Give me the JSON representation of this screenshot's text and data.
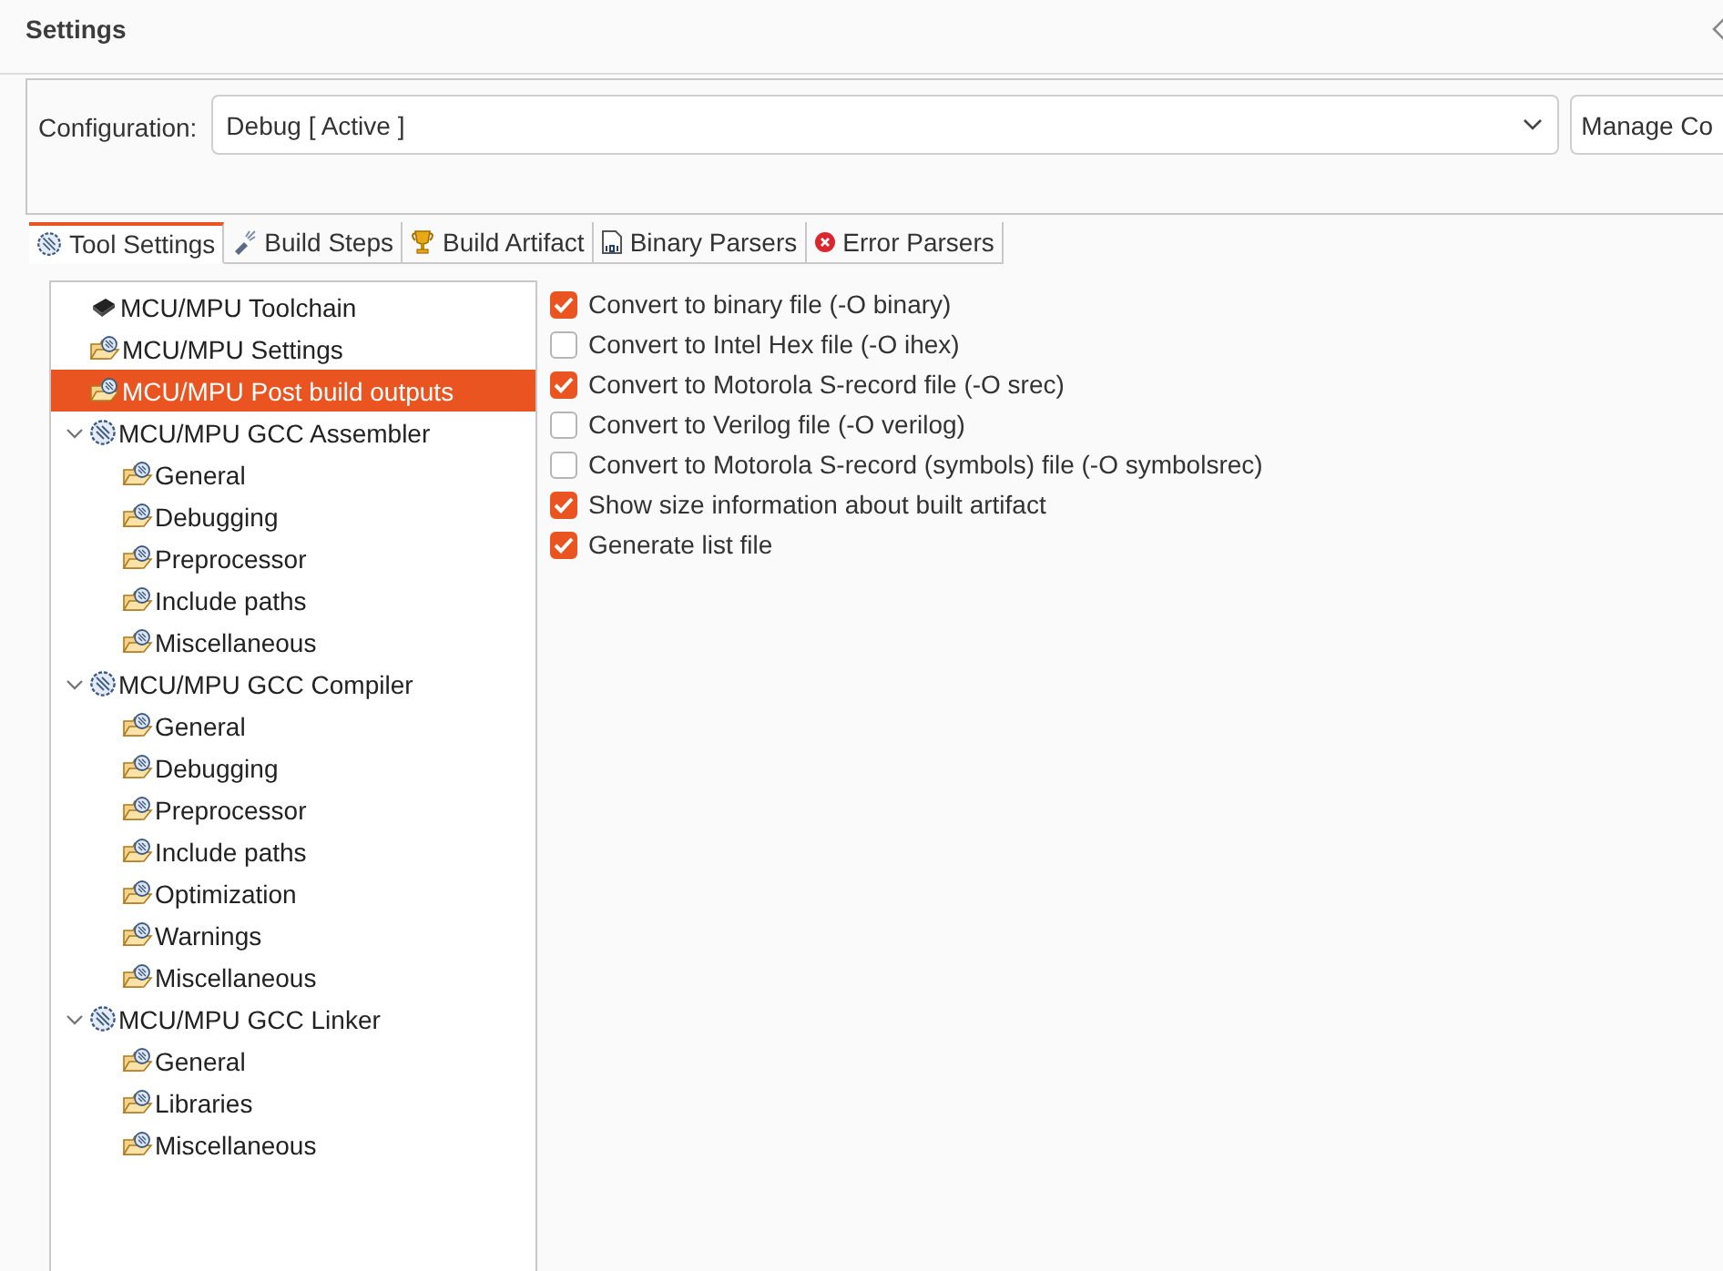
{
  "window": {
    "title": "Settings"
  },
  "configuration": {
    "label": "Configuration:",
    "value": "Debug  [ Active ]",
    "manage_button": "Manage Co"
  },
  "tabs": [
    {
      "label": "Tool Settings",
      "kind": "tool",
      "selected": true
    },
    {
      "label": "Build Steps",
      "kind": "steps",
      "selected": false
    },
    {
      "label": "Build Artifact",
      "kind": "trophy",
      "selected": false
    },
    {
      "label": "Binary Parsers",
      "kind": "binary",
      "selected": false
    },
    {
      "label": "Error Parsers",
      "kind": "error",
      "selected": false
    }
  ],
  "tree": [
    {
      "label": "MCU/MPU Toolchain",
      "kind": "chip",
      "selected": false
    },
    {
      "label": "MCU/MPU Settings",
      "kind": "folder",
      "selected": false
    },
    {
      "label": "MCU/MPU Post build outputs",
      "kind": "folder",
      "selected": true
    },
    {
      "label": "MCU/MPU GCC Assembler",
      "kind": "tool",
      "selected": false,
      "expanded": true,
      "children": [
        {
          "label": "General",
          "kind": "folder",
          "selected": false
        },
        {
          "label": "Debugging",
          "kind": "folder",
          "selected": false
        },
        {
          "label": "Preprocessor",
          "kind": "folder",
          "selected": false
        },
        {
          "label": "Include paths",
          "kind": "folder",
          "selected": false
        },
        {
          "label": "Miscellaneous",
          "kind": "folder",
          "selected": false
        }
      ]
    },
    {
      "label": "MCU/MPU GCC Compiler",
      "kind": "tool",
      "selected": false,
      "expanded": true,
      "children": [
        {
          "label": "General",
          "kind": "folder",
          "selected": false
        },
        {
          "label": "Debugging",
          "kind": "folder",
          "selected": false
        },
        {
          "label": "Preprocessor",
          "kind": "folder",
          "selected": false
        },
        {
          "label": "Include paths",
          "kind": "folder",
          "selected": false
        },
        {
          "label": "Optimization",
          "kind": "folder",
          "selected": false
        },
        {
          "label": "Warnings",
          "kind": "folder",
          "selected": false
        },
        {
          "label": "Miscellaneous",
          "kind": "folder",
          "selected": false
        }
      ]
    },
    {
      "label": "MCU/MPU GCC Linker",
      "kind": "tool",
      "selected": false,
      "expanded": true,
      "children": [
        {
          "label": "General",
          "kind": "folder",
          "selected": false
        },
        {
          "label": "Libraries",
          "kind": "folder",
          "selected": false
        },
        {
          "label": "Miscellaneous",
          "kind": "folder",
          "selected": false
        }
      ]
    }
  ],
  "options": [
    {
      "label": "Convert to binary file (-O binary)",
      "checked": true
    },
    {
      "label": "Convert to Intel Hex file (-O ihex)",
      "checked": false
    },
    {
      "label": "Convert to Motorola S-record file (-O srec)",
      "checked": true
    },
    {
      "label": "Convert to Verilog file (-O verilog)",
      "checked": false
    },
    {
      "label": "Convert to Motorola S-record (symbols) file (-O symbolsrec)",
      "checked": false
    },
    {
      "label": "Show size information about built artifact",
      "checked": true
    },
    {
      "label": "Generate list file",
      "checked": true
    }
  ]
}
